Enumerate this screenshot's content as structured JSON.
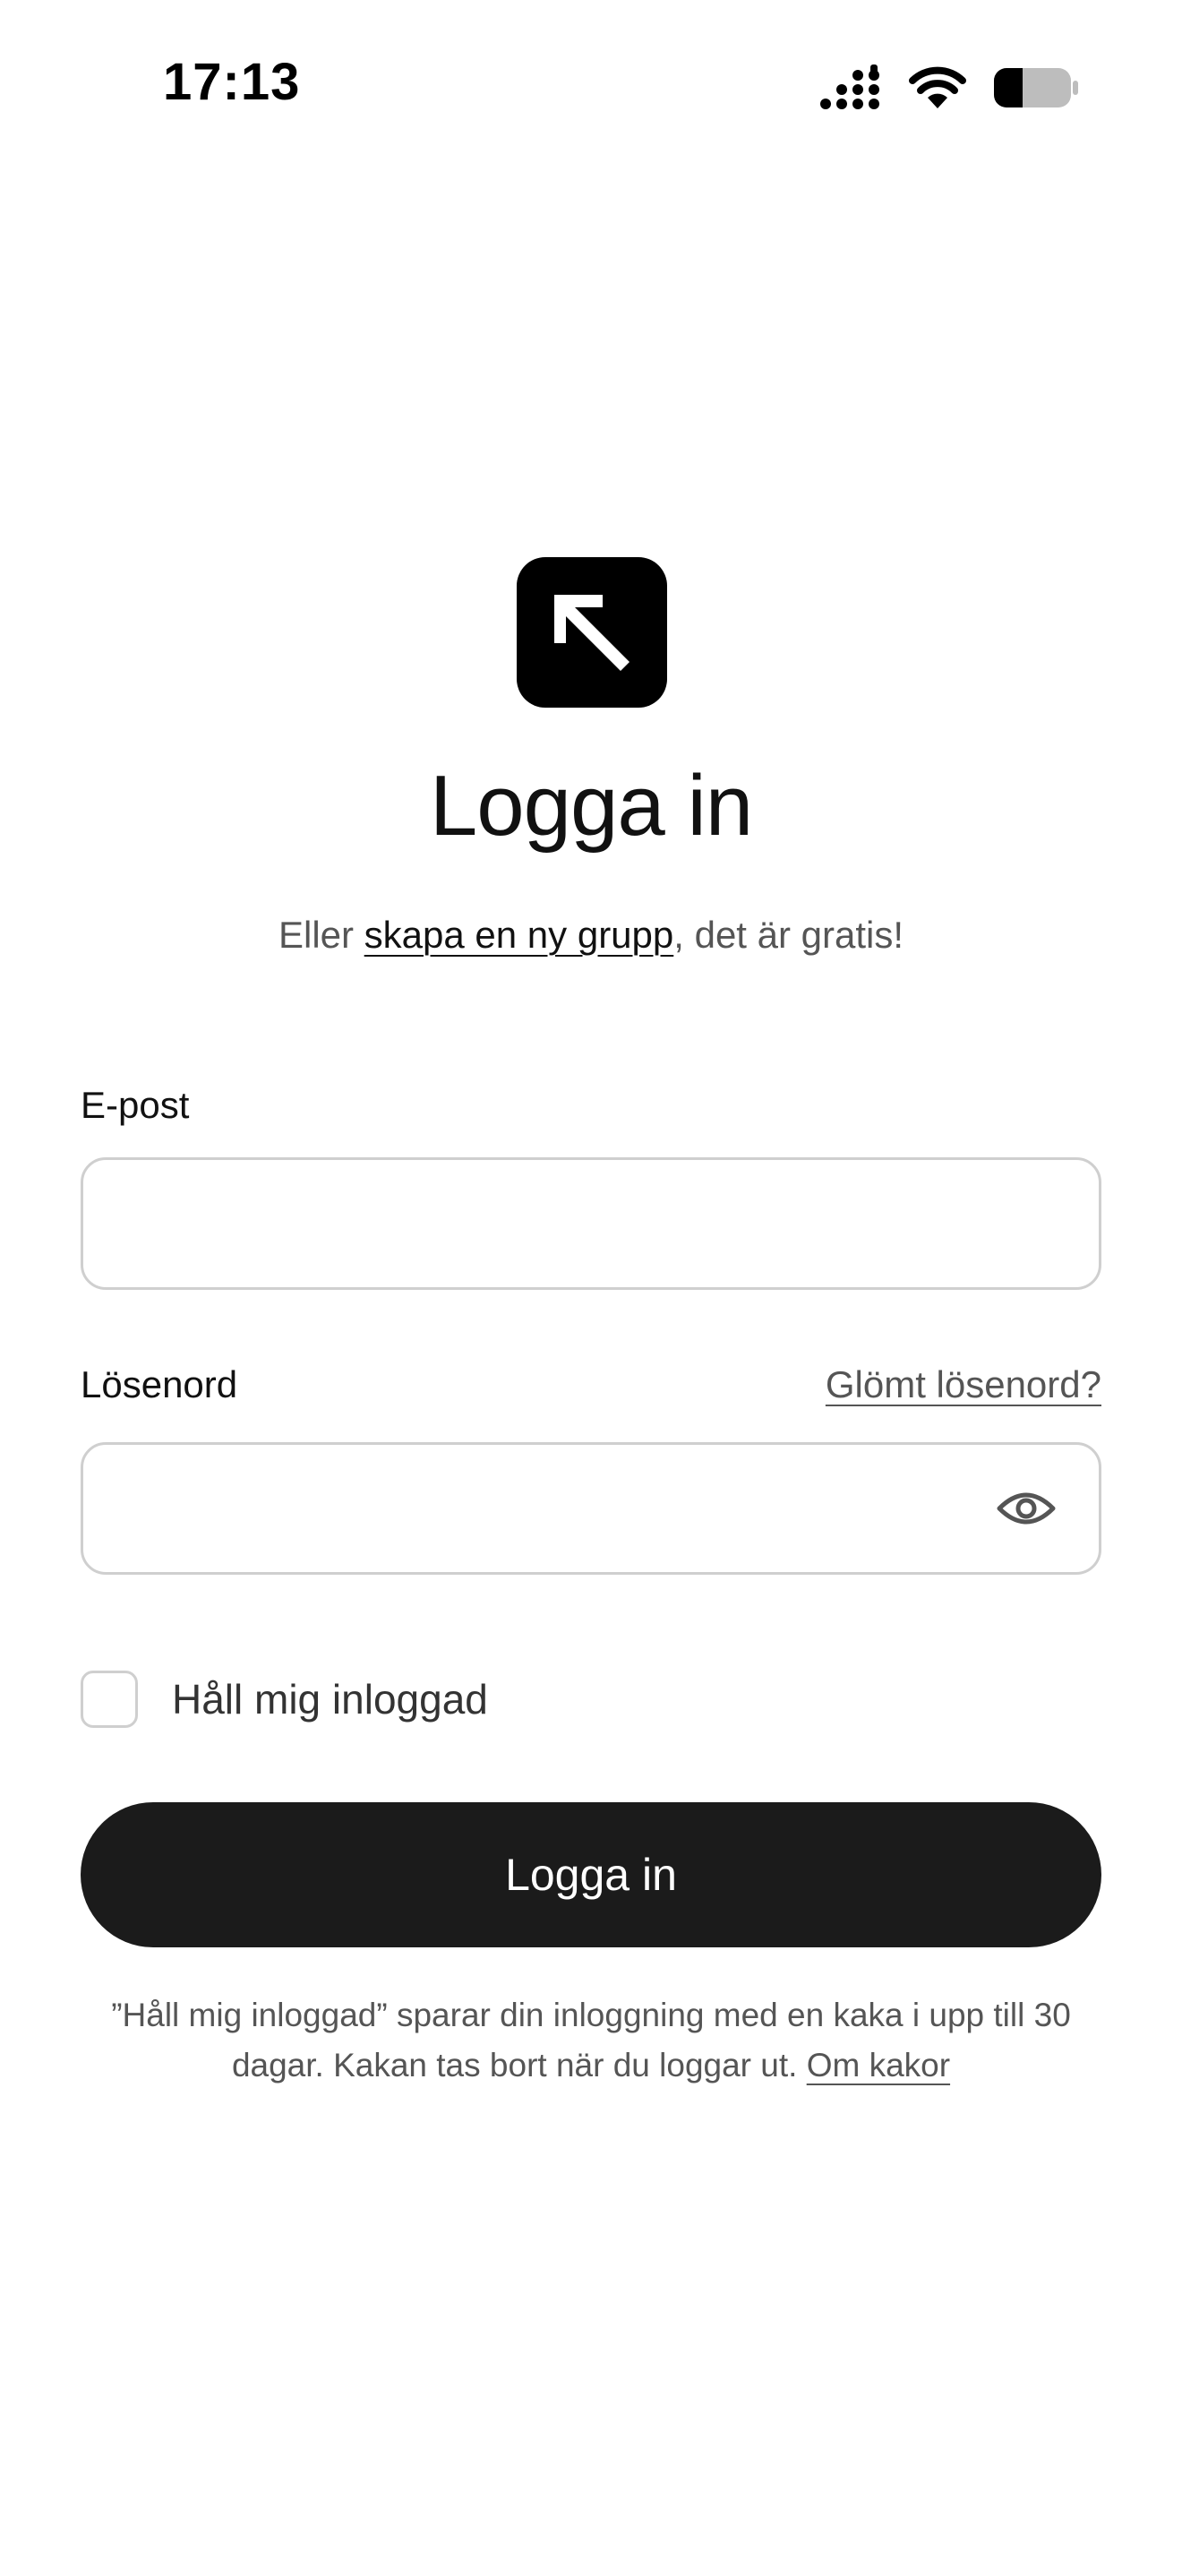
{
  "status_bar": {
    "time": "17:13",
    "icons": [
      "signal-icon",
      "wifi-icon",
      "battery-icon"
    ]
  },
  "logo": {
    "icon": "arrow-up-left-icon",
    "background": "#000000"
  },
  "title": "Logga in",
  "subtitle": {
    "prefix": "Eller ",
    "link": "skapa en ny grupp",
    "suffix": ", det är gratis!"
  },
  "email": {
    "label": "E-post",
    "value": "",
    "placeholder": ""
  },
  "password": {
    "label": "Lösenord",
    "forgot_link": "Glömt lösenord?",
    "value": "",
    "placeholder": "",
    "toggle_icon": "eye-icon"
  },
  "remember": {
    "label": "Håll mig inloggad",
    "checked": false
  },
  "submit_label": "Logga in",
  "footnote": {
    "text": "”Håll mig inloggad” sparar din inloggning med en kaka i upp till 30 dagar. Kakan tas bort när du loggar ut. ",
    "link": "Om kakor"
  },
  "colors": {
    "primary_button": "#1b1b1b",
    "input_border": "#cfcfcf",
    "muted_text": "#555555"
  }
}
